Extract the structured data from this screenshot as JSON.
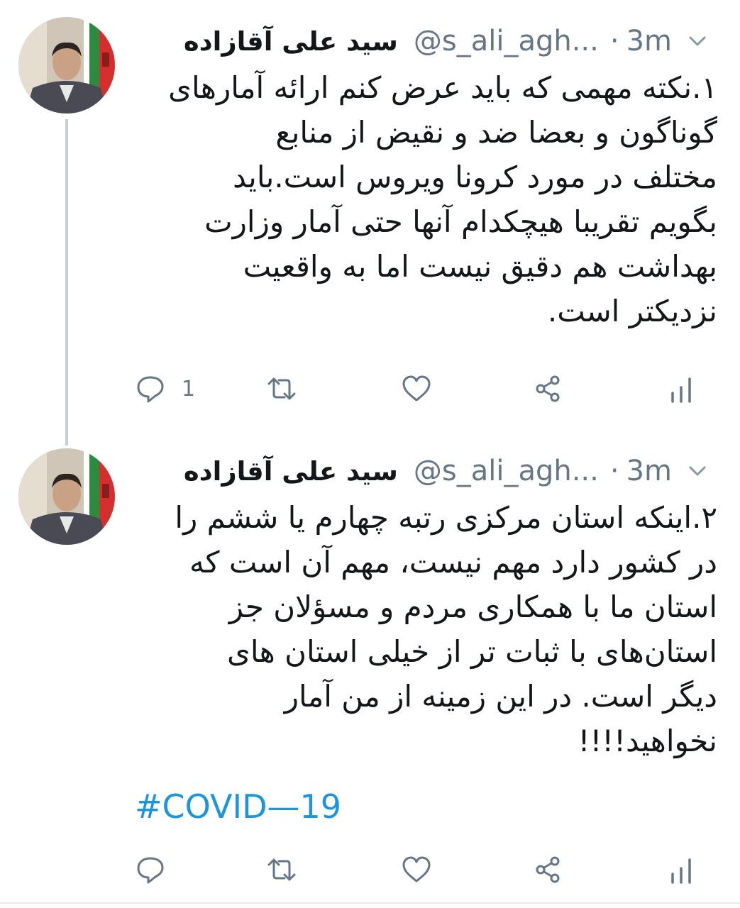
{
  "tweets": [
    {
      "author_name": "سید علی آقازاده",
      "handle": "@s_ali_agh...",
      "separator": "·",
      "time": "3m",
      "lines": [
        "۱.نکته مهمی که باید عرض کنم ارائه آمارهای",
        "گوناگون و بعضا ضد و نقیض از منابع",
        "مختلف در مورد کرونا ویروس است.باید",
        "بگویم تقریبا هیچکدام آنها حتی آمار وزارت",
        "بهداشت هم دقیق نیست اما به واقعیت",
        "نزدیکتر است."
      ],
      "reply_count": "1"
    },
    {
      "author_name": "سید علی آقازاده",
      "handle": "@s_ali_agh...",
      "separator": "·",
      "time": "3m",
      "lines": [
        "۲.اینکه استان مرکزی رتبه چهارم یا ششم را",
        "در کشور دارد مهم نیست، مهم آن است که",
        "استان ما با همکاری مردم و مسؤلان جز",
        "استان‌های با ثبات تر از خیلی استان های",
        "دیگر است. در این زمینه از من آمار",
        "نخواهید!!!!"
      ],
      "hashtag": "#COVID—19"
    }
  ],
  "colors": {
    "text": "#14171a",
    "secondary": "#657786",
    "link": "#1b95e0",
    "thread_line": "#c4cfd6"
  },
  "icons": {
    "reply": "reply-icon",
    "retweet": "retweet-icon",
    "like": "heart-icon",
    "share": "share-icon",
    "analytics": "analytics-icon",
    "caret": "chevron-down-icon"
  }
}
